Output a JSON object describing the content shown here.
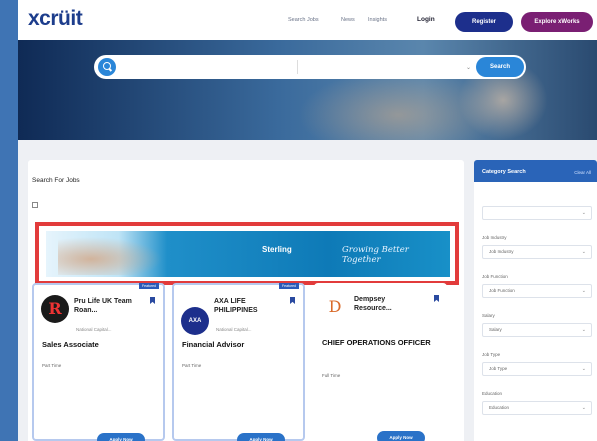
{
  "header": {
    "logo": "xcrüit",
    "logo_tagline": "",
    "nav": [
      "Search Jobs",
      "News",
      "Insights"
    ],
    "login": "Login",
    "register": "Register",
    "explore": "Explore xWorks"
  },
  "search": {
    "placeholder": "",
    "location": "",
    "button": "Search"
  },
  "main": {
    "title": "Search For Jobs",
    "count": "",
    "sort": "",
    "checkbox_label": ""
  },
  "banner": {
    "logo1": "",
    "logo2": "Sterling",
    "tagline": "Growing Better Together"
  },
  "jobs": [
    {
      "featured": "Featured",
      "company": "Pru Life UK Team Roan...",
      "logo_letter": "R",
      "logo_color": "#1a1a1a",
      "location": "National Capital...",
      "title": "Sales Associate",
      "salary": "",
      "type": "Part Time",
      "posted": "",
      "desc": ""
    },
    {
      "featured": "Featured",
      "company": "AXA LIFE PHILIPPINES",
      "logo_letter": "AXA",
      "logo_color": "#1d2f8c",
      "location": "National Capital...",
      "title": "Financial Advisor",
      "salary": "",
      "type": "Part Time",
      "posted": "",
      "desc": ""
    },
    {
      "featured": "",
      "company": "Dempsey Resource...",
      "logo_letter": "D",
      "logo_color": "#d96a2a",
      "location": "",
      "title": "CHIEF OPERATIONS OFFICER",
      "salary": "",
      "type": "Full Time",
      "posted": "",
      "desc": ""
    }
  ],
  "apply_label": "Apply Now",
  "sidebar": {
    "title": "Category Search",
    "clear": "Clear All",
    "filters": [
      {
        "label": "",
        "value": ""
      },
      {
        "label": "Job Industry",
        "value": "Job Industry"
      },
      {
        "label": "Job Function",
        "value": "Job Function"
      },
      {
        "label": "Salary",
        "value": "Salary"
      },
      {
        "label": "Job Type",
        "value": "Job Type"
      },
      {
        "label": "Education",
        "value": "Education"
      },
      {
        "label": "",
        "value": ""
      }
    ]
  },
  "colors": {
    "primary": "#1d2f8c",
    "accent": "#7a1f73",
    "link": "#2a86d8",
    "highlight": "#e23b3b"
  }
}
